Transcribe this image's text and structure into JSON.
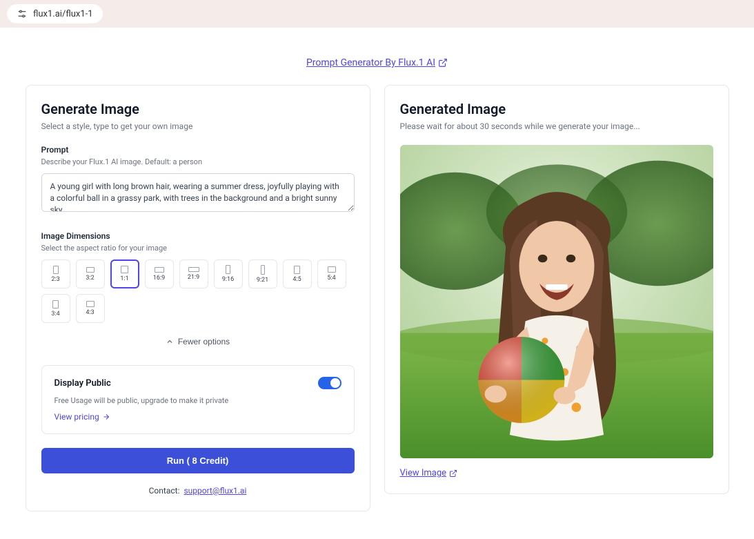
{
  "url": "flux1.ai/flux1-1",
  "topLink": {
    "label": "Prompt Generator By Flux.1 AI"
  },
  "generate": {
    "title": "Generate Image",
    "subtitle": "Select a style, type to get your own image",
    "promptLabel": "Prompt",
    "promptHint": "Describe your Flux.1 AI image. Default: a person",
    "promptValue": "A young girl with long brown hair, wearing a summer dress, joyfully playing with a colorful ball in a grassy park, with trees in the background and a bright sunny sky.",
    "dimsLabel": "Image Dimensions",
    "dimsHint": "Select the aspect ratio for your image",
    "ratios": [
      {
        "id": "2:3",
        "label": "2:3",
        "w": 8,
        "h": 12
      },
      {
        "id": "3:2",
        "label": "3:2",
        "w": 12,
        "h": 8
      },
      {
        "id": "1:1",
        "label": "1:1",
        "w": 11,
        "h": 11,
        "selected": true
      },
      {
        "id": "16:9",
        "label": "16:9",
        "w": 14,
        "h": 8
      },
      {
        "id": "21:9",
        "label": "21:9",
        "w": 16,
        "h": 7
      },
      {
        "id": "9:16",
        "label": "9:16",
        "w": 7,
        "h": 13
      },
      {
        "id": "9:21",
        "label": "9:21",
        "w": 6,
        "h": 14
      },
      {
        "id": "4:5",
        "label": "4:5",
        "w": 9,
        "h": 12
      },
      {
        "id": "5:4",
        "label": "5:4",
        "w": 12,
        "h": 9
      },
      {
        "id": "3:4",
        "label": "3:4",
        "w": 9,
        "h": 12
      },
      {
        "id": "4:3",
        "label": "4:3",
        "w": 12,
        "h": 9
      }
    ],
    "fewerOptions": "Fewer options",
    "displayPublic": {
      "title": "Display Public",
      "note": "Free Usage will be public, upgrade to make it private",
      "link": "View pricing",
      "toggleOn": true
    },
    "runLabel": "Run   ( 8 Credit)",
    "contactLabel": "Contact:",
    "contactEmail": "support@flux1.ai"
  },
  "generated": {
    "title": "Generated Image",
    "waitNote": "Please wait for about 30 seconds while we generate your image...",
    "viewLabel": "View Image"
  }
}
